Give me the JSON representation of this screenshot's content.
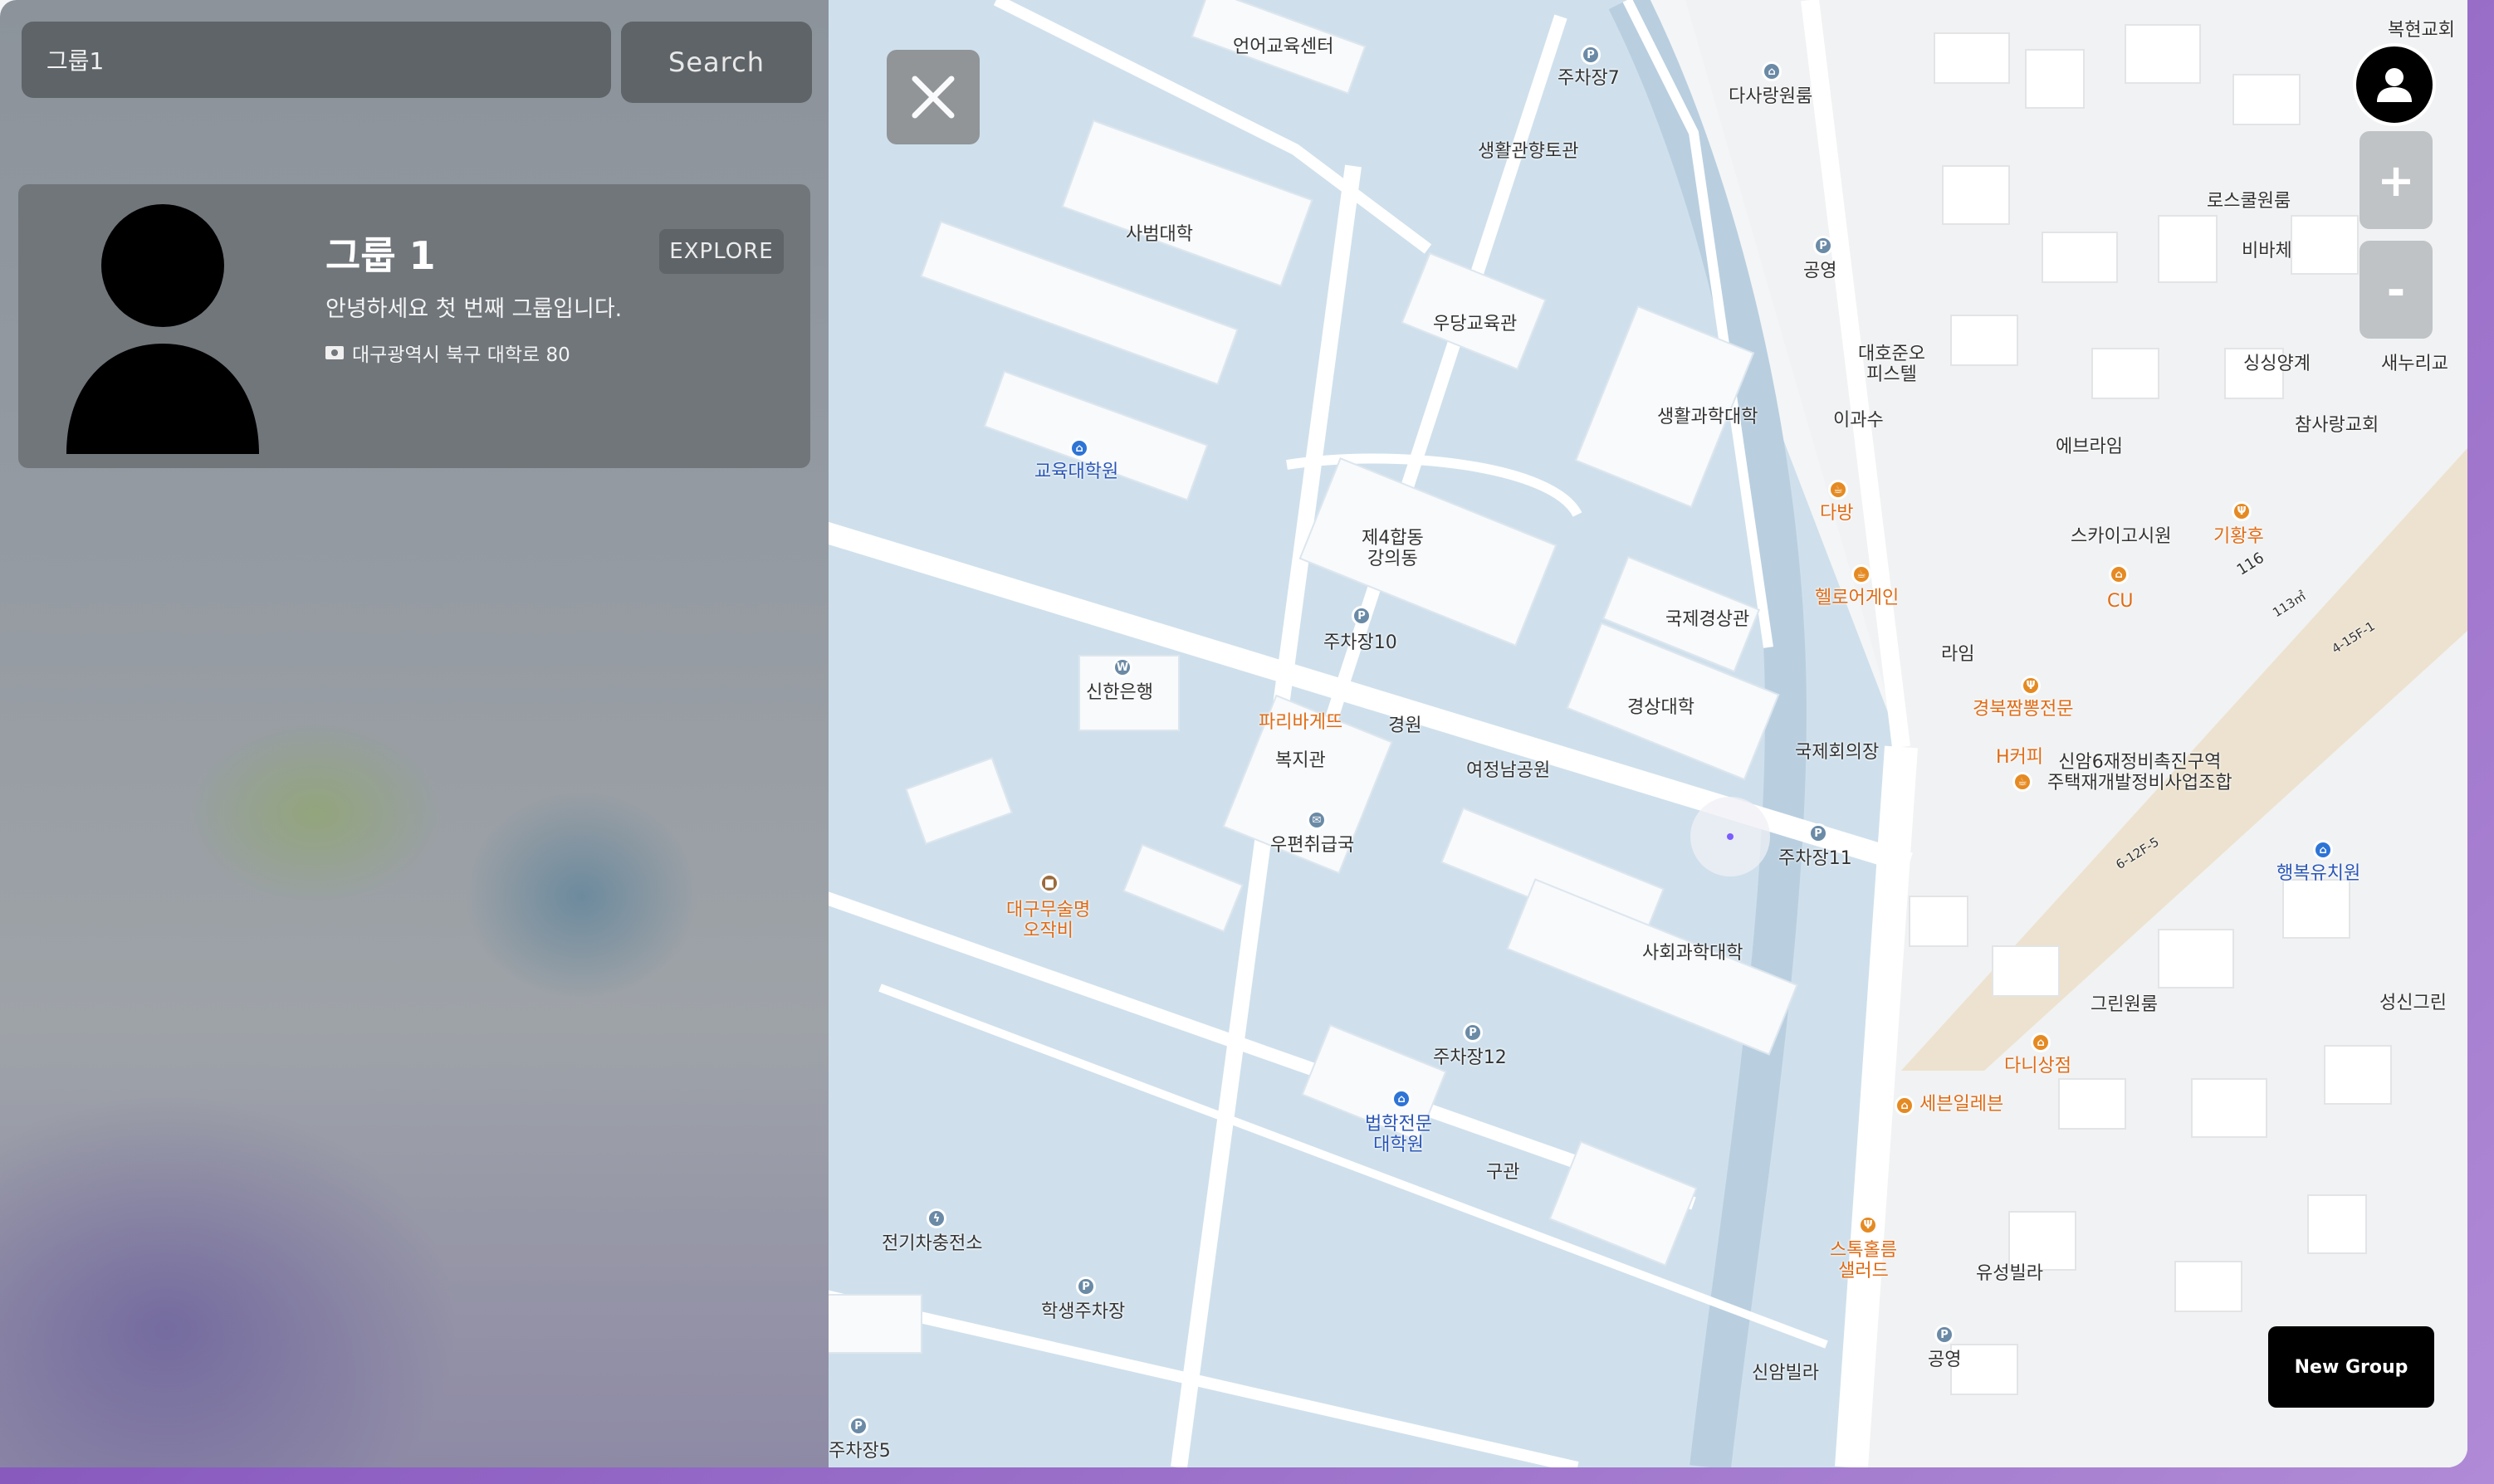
{
  "sidebar": {
    "search": {
      "value": "그룹1",
      "placeholder": ""
    },
    "search_button": "Search",
    "group": {
      "name": "그룹 1",
      "explore_label": "EXPLORE",
      "description": "안녕하세요 첫 번째 그룹입니다.",
      "address": "대구광역시 북구 대학로 80"
    }
  },
  "map": {
    "labels": {
      "l1": "언어교육센터",
      "l2": "주차장7",
      "l3": "생활관향토관",
      "l4": "사범대학",
      "l5": "우당교육관",
      "l6": "생활과학대학",
      "l7": "교육대학원",
      "l8": "제4합동\n강의동",
      "l9": "주차장10",
      "l10": "신한은행",
      "l11": "파리바게뜨",
      "l12": "경원",
      "l13": "복지관",
      "l14": "여정남공원",
      "l15": "국제경상관",
      "l16": "경상대학",
      "l17": "국제회의장",
      "l18": "우편취급국",
      "l19": "대구무술명\n오작비",
      "l20": "주차장11",
      "l21": "사회과학대학",
      "l22": "주차장12",
      "l23": "법학전문\n대학원",
      "l24": "구관",
      "l25": "전기차충전소",
      "l26": "학생주차장",
      "l27": "주차장5",
      "l28": "다사랑원룸",
      "l29": "공영",
      "l30": "대호준오\n피스텔",
      "l31": "이과수",
      "l32": "다방",
      "l33": "헬로어게인",
      "l34": "라임",
      "l35": "경북짬뽕전문",
      "l36": "H커피",
      "l37": "신암6재정비촉진구역\n주택재개발정비사업조합",
      "l38": "에브라임",
      "l39": "스카이고시원",
      "l40": "기황후",
      "l41": "CU",
      "l42": "로스쿨원룸",
      "l43": "비바체",
      "l44": "싱싱양계",
      "l45": "참사랑교회",
      "l46": "새누리교",
      "l47": "행복유치원",
      "l48": "그린원룸",
      "l49": "다니상점",
      "l50": "세븐일레븐",
      "l51": "스톡홀름\n샐러드",
      "l52": "유성빌라",
      "l53": "공영",
      "l54": "신암빌라",
      "l55": "성신그린",
      "l56": "복현교회",
      "l57": "116",
      "l58": "113㎡",
      "l59": "4-15F-1",
      "l60": "6-12F-5"
    }
  },
  "controls": {
    "zoom_in": "+",
    "zoom_out": "-",
    "new_group": "New Group"
  },
  "icons": [
    "close-icon",
    "user-icon",
    "location-pin-icon",
    "address-icon"
  ],
  "colors": {
    "pin": "#6a00ff",
    "campus": "#cfe0ec",
    "building": "#f7f9fb",
    "sidebar_card": "#71767b"
  }
}
